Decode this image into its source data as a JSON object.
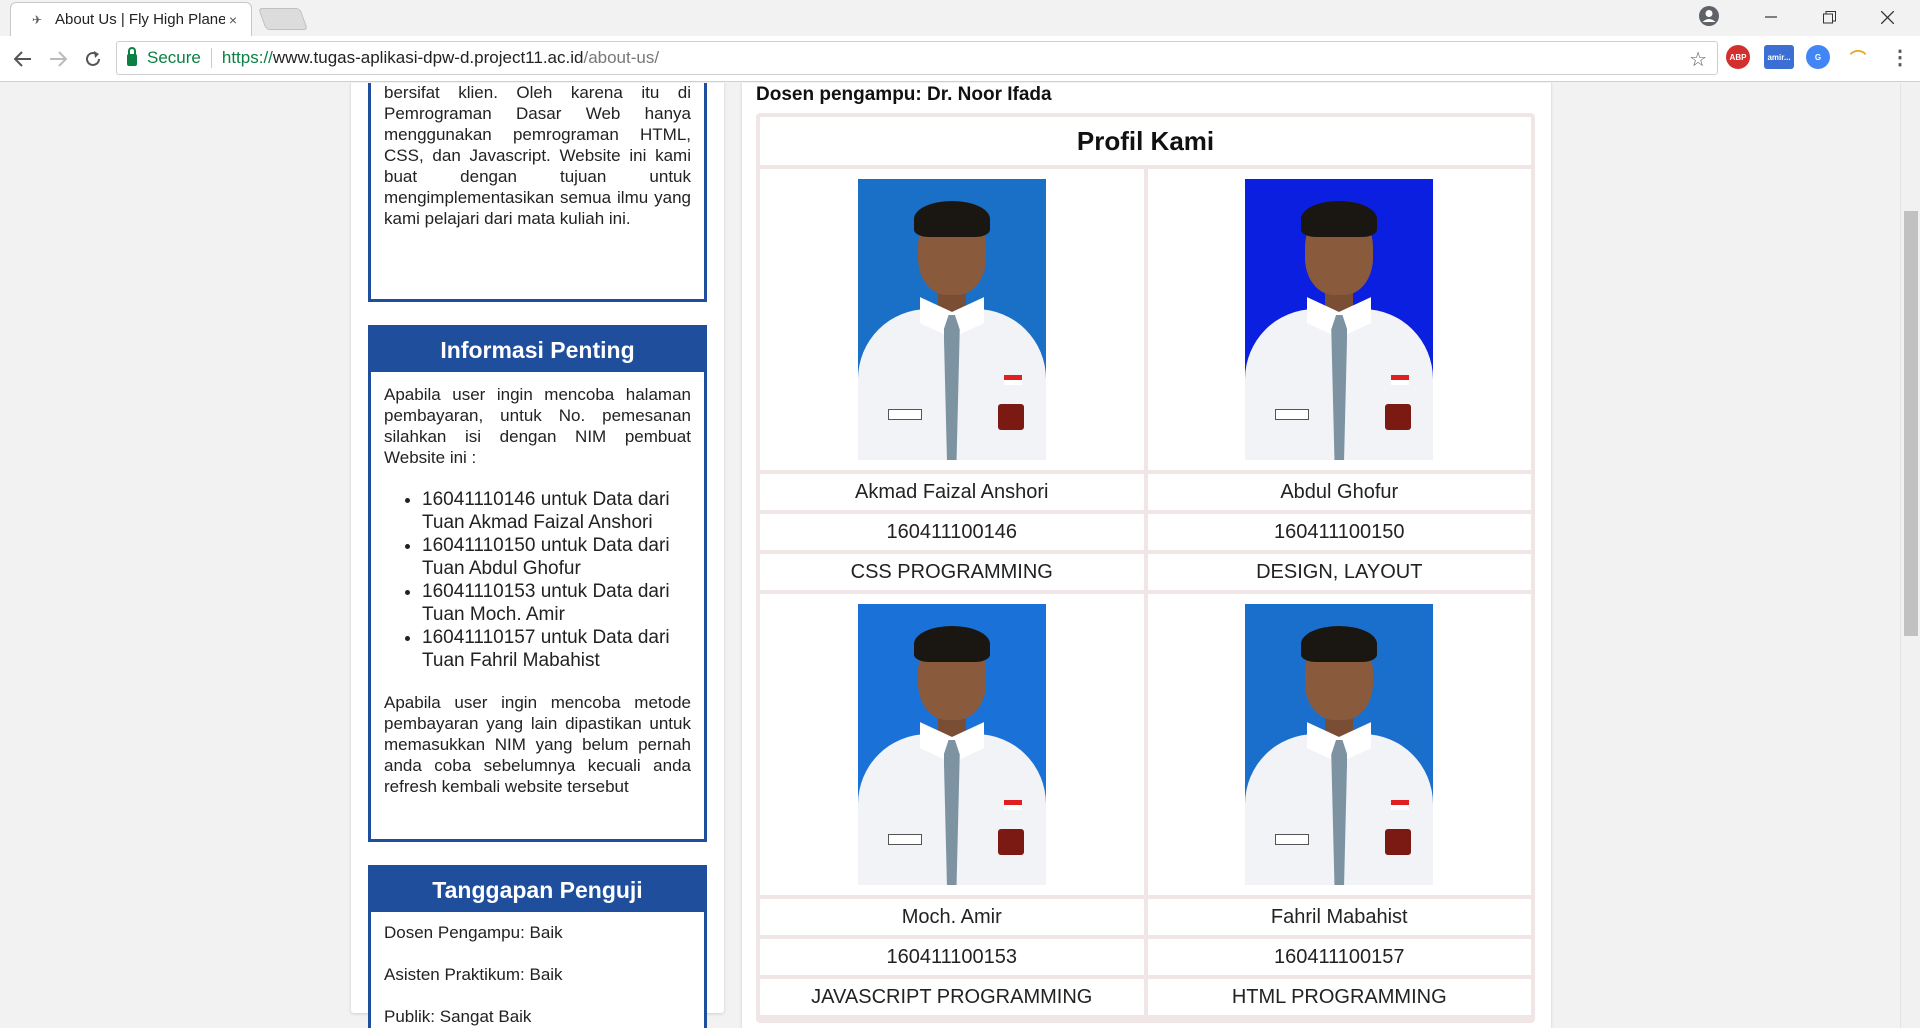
{
  "browser": {
    "tab_title": "About Us | Fly High Plane",
    "tab_close": "×",
    "secure_label": "Secure",
    "url_scheme": "https://",
    "url_host": "www.tugas-aplikasi-dpw-d.project11.ac.id",
    "url_path": "/about-us/",
    "extensions": [
      {
        "name": "abp-icon",
        "label": "ABP",
        "color": "#d32f2f"
      },
      {
        "name": "amir-extension-icon",
        "label": "amir...",
        "color": "#3b6fd4"
      },
      {
        "name": "translate-icon",
        "label": "G",
        "color": "#4285f4"
      },
      {
        "name": "colorful-extension-icon",
        "label": "",
        "color": "#e8a317"
      }
    ]
  },
  "left": {
    "intro_text": "bersifat klien. Oleh karena itu di Pemrograman Dasar Web hanya menggunakan pemrograman HTML, CSS, dan Javascript. Website ini kami buat dengan tujuan untuk mengimplementasikan semua ilmu yang kami pelajari dari mata kuliah ini.",
    "info": {
      "title": "Informasi Penting",
      "para1": "Apabila user ingin mencoba halaman pembayaran, untuk No. pemesanan silahkan isi dengan NIM pembuat Website ini :",
      "items": [
        "16041110146 untuk Data dari Tuan Akmad Faizal Anshori",
        "16041110150 untuk Data dari Tuan Abdul Ghofur",
        "16041110153 untuk Data dari Tuan Moch. Amir",
        "16041110157 untuk Data dari Tuan Fahril Mabahist"
      ],
      "para2": "Apabila user ingin mencoba metode pembayaran yang lain dipastikan untuk memasukkan NIM yang belum pernah anda coba sebelumnya kecuali anda refresh kembali website tersebut"
    },
    "responses": {
      "title": "Tanggapan Penguji",
      "items": [
        "Dosen Pengampu: Baik",
        "Asisten Praktikum: Baik",
        "Publik: Sangat Baik"
      ]
    }
  },
  "right": {
    "dosen": "Dosen pengampu: Dr. Noor Ifada",
    "profile_title": "Profil Kami",
    "members": [
      {
        "name": "Akmad Faizal Anshori",
        "nim": "160411100146",
        "role": "CSS PROGRAMMING",
        "bg": "#1a6fc7"
      },
      {
        "name": "Abdul Ghofur",
        "nim": "160411100150",
        "role": "DESIGN, LAYOUT",
        "bg": "#0a1fe0"
      },
      {
        "name": "Moch. Amir",
        "nim": "160411100153",
        "role": "JAVASCRIPT PROGRAMMING",
        "bg": "#1a72d8"
      },
      {
        "name": "Fahril Mabahist",
        "nim": "160411100157",
        "role": "HTML PROGRAMMING",
        "bg": "#1a6fcc"
      }
    ]
  }
}
